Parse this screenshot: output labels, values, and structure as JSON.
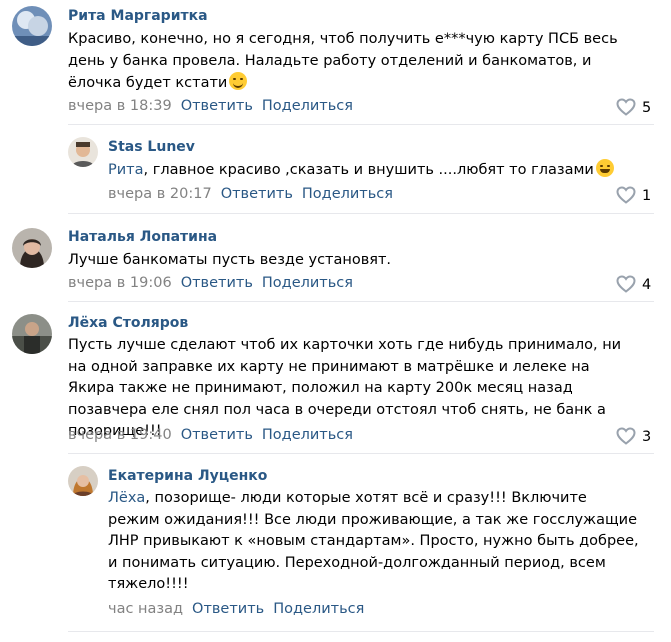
{
  "comments": [
    {
      "author": "Рита Маргаритка",
      "text": "Красиво, конечно, но я сегодня, чтоб получить е***чую карту ПСБ весь день у банка провела. Наладьте работу отделений и банкоматов, и ёлочка будет кстати",
      "time": "вчера в 18:39",
      "reply_label": "Ответить",
      "share_label": "Поделиться",
      "likes": "5"
    },
    {
      "author": "Stas Lunev",
      "reply_to": "Рита",
      "text": ", главное красиво ,сказать и внушить ....любят то глазами",
      "time": "вчера в 20:17",
      "reply_label": "Ответить",
      "share_label": "Поделиться",
      "likes": "1"
    },
    {
      "author": "Наталья Лопатина",
      "text": "Лучше банкоматы пусть везде установят.",
      "time": "вчера в 19:06",
      "reply_label": "Ответить",
      "share_label": "Поделиться",
      "likes": "4"
    },
    {
      "author": "Лёха Столяров",
      "text": "Пусть лучше сделают чтоб их карточки хоть где нибудь принимало, ни на одной заправке их карту не принимают в матрёшке и лелеке на Якира также не принимают, положил на карту 200к месяц назад позавчера еле снял пол часа в очереди отстоял чтоб снять, не банк а позорище!!!",
      "time": "вчера в 19:40",
      "reply_label": "Ответить",
      "share_label": "Поделиться",
      "likes": "3"
    },
    {
      "author": "Екатерина Луценко",
      "reply_to": "Лёха",
      "text": ", позорище- люди которые хотят всё и сразу!!! Включите режим ожидания!!! Все люди проживающие, а так же госслужащие ЛНР привыкают к «новым стандартам». Просто, нужно быть добрее, и понимать ситуацию. Переходной-долгожданный период, всем тяжело!!!!",
      "time": "час назад",
      "reply_label": "Ответить",
      "share_label": "Поделиться"
    }
  ],
  "colors": {
    "link": "#2a5885",
    "meta": "#828282",
    "divider": "#e7e8ec",
    "icon": "#99a2ad"
  },
  "icons": {
    "like": "heart-outline-icon",
    "emoji_1": "smirk-emoji-icon",
    "emoji_2": "laughing-emoji-icon"
  }
}
